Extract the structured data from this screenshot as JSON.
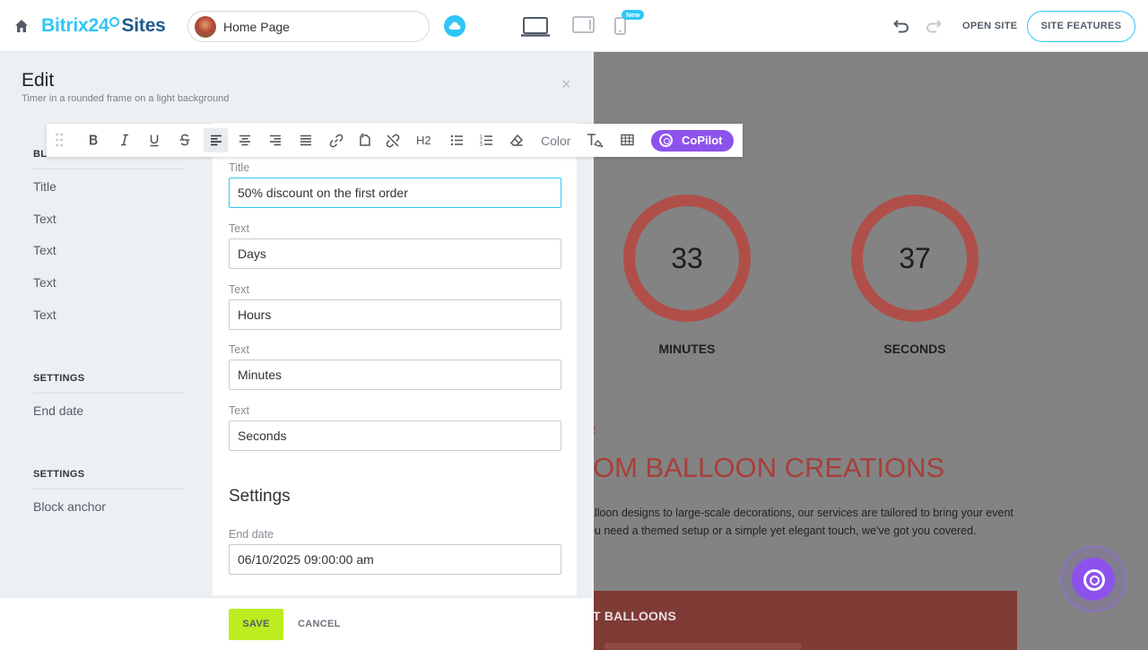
{
  "topbar": {
    "logo_b24": "Bitrix24",
    "logo_sites": "Sites",
    "page_name": "Home Page",
    "new_badge": "New",
    "open_site": "OPEN SITE",
    "site_features": "SITE FEATURES"
  },
  "edit": {
    "title": "Edit",
    "subtitle": "Timer in a rounded frame on a light background",
    "close": "×"
  },
  "nav": {
    "block_header": "BLO",
    "block_items": [
      "Title",
      "Text",
      "Text",
      "Text",
      "Text"
    ],
    "settings_header_1": "SETTINGS",
    "settings_items_1": [
      "End date"
    ],
    "settings_header_2": "SETTINGS",
    "settings_items_2": [
      "Block anchor"
    ]
  },
  "form": {
    "fields": [
      {
        "label": "Title",
        "value": "50% discount on the first order"
      },
      {
        "label": "Text",
        "value": "Days"
      },
      {
        "label": "Text",
        "value": "Hours"
      },
      {
        "label": "Text",
        "value": "Minutes"
      },
      {
        "label": "Text",
        "value": "Seconds"
      }
    ],
    "settings_title": "Settings",
    "end_date_label": "End date",
    "end_date_value": "06/10/2025 09:00:00 am"
  },
  "footer": {
    "save": "SAVE",
    "cancel": "CANCEL"
  },
  "toolbar": {
    "h2": "H2",
    "color": "Color",
    "copilot": "CoPilot"
  },
  "preview": {
    "minutes_value": "33",
    "seconds_value": "37",
    "minutes_label": "MINUTES",
    "seconds_label": "SECONDS",
    "tag": "R",
    "heading": "OM BALLOON CREATIONS",
    "description_line1": "alloon designs to large-scale decorations, our services are tailored to bring your event",
    "description_line2": "ou need a themed setup or a simple yet elegant touch, we've got you covered.",
    "box_title": "T BALLOONS"
  },
  "colors": {
    "accent": "#2fc6f6",
    "brand_dark": "#1e5a8c",
    "save_green": "#bbed21",
    "copilot_purple": "#8e52ec",
    "timer_red": "#b04f49"
  }
}
